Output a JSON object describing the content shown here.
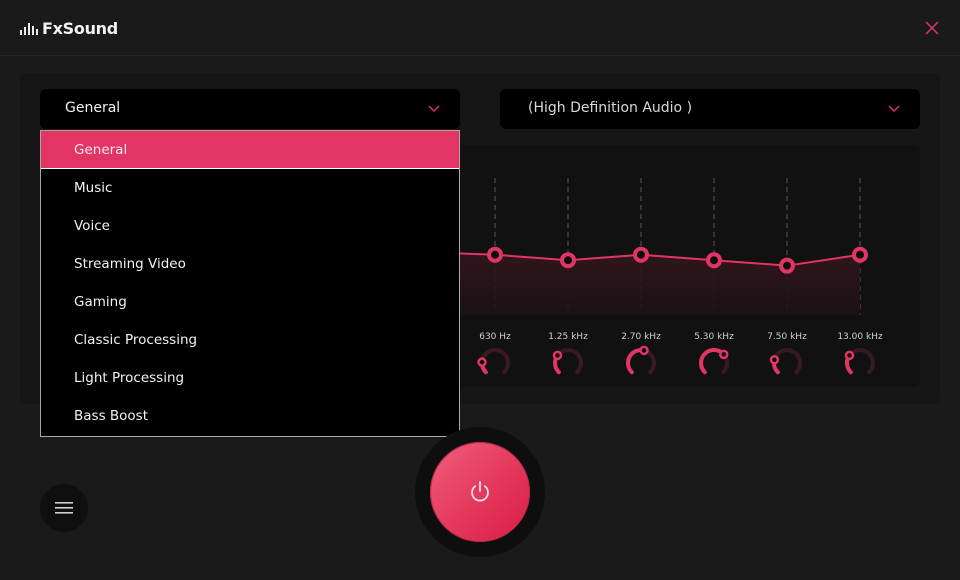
{
  "app": {
    "title": "FxSound",
    "accent_color": "#e33563"
  },
  "titlebar": {
    "logo_icon": "equalizer-bars-icon",
    "close_icon": "close-icon"
  },
  "preset_select": {
    "value": "General",
    "chevron_icon": "chevron-down-icon",
    "open": true,
    "options": [
      {
        "label": "General",
        "selected": true
      },
      {
        "label": "Music",
        "selected": false
      },
      {
        "label": "Voice",
        "selected": false
      },
      {
        "label": "Streaming Video",
        "selected": false
      },
      {
        "label": "Gaming",
        "selected": false
      },
      {
        "label": "Classic Processing",
        "selected": false
      },
      {
        "label": "Light Processing",
        "selected": false
      },
      {
        "label": "Bass Boost",
        "selected": false
      }
    ]
  },
  "device_select": {
    "value": "(High Definition Audio )",
    "chevron_icon": "chevron-down-icon"
  },
  "equalizer": {
    "visible_bands": [
      {
        "label": "630 Hz",
        "level": 0.44
      },
      {
        "label": "1.25 kHz",
        "level": 0.4
      },
      {
        "label": "2.70 kHz",
        "level": 0.44
      },
      {
        "label": "5.30 kHz",
        "level": 0.4
      },
      {
        "label": "7.50 kHz",
        "level": 0.36
      },
      {
        "label": "13.00 kHz",
        "level": 0.44
      }
    ],
    "knob_levels": [
      0.18,
      0.3,
      0.55,
      0.68,
      0.22,
      0.3
    ]
  },
  "power_button": {
    "icon": "power-icon",
    "state": "on"
  },
  "menu_button": {
    "icon": "hamburger-menu-icon"
  }
}
